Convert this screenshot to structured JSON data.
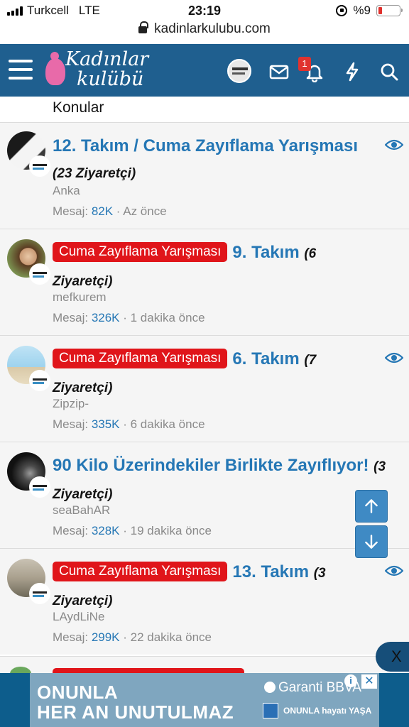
{
  "status_bar": {
    "carrier": "Turkcell",
    "network": "LTE",
    "time": "23:19",
    "battery": "%9",
    "battery_level": 0.09
  },
  "browser": {
    "url": "kadinlarkulubu.com"
  },
  "header": {
    "logo_line1": "Kadınlar",
    "logo_line2": "kulübü",
    "notification_count": "1",
    "colors": {
      "bar": "#1f5f8f",
      "logo_accent": "#e86aa9"
    }
  },
  "section": {
    "label": "Konular"
  },
  "threads": [
    {
      "prefix": "",
      "title": "12. Takım / Cuma Zayıflama Yarışması",
      "visitors": "(23 Ziyaretçi)",
      "author": "Anka",
      "messages_label": "Mesaj:",
      "messages": "82K",
      "time": "· Az önce",
      "watched": true,
      "avatar_icon": "group-banner-avatar"
    },
    {
      "prefix": "Cuma Zayıflama Yarışması",
      "title": "9. Takım",
      "visitors": "(6 Ziyaretçi)",
      "author": "mefkurem",
      "messages_label": "Mesaj:",
      "messages": "326K",
      "time": "· 1 dakika önce",
      "watched": false,
      "avatar_icon": "woman-portrait-avatar"
    },
    {
      "prefix": "Cuma Zayıflama Yarışması",
      "title": "6. Takım",
      "visitors": "(7 Ziyaretçi)",
      "author": "Zipzip-",
      "messages_label": "Mesaj:",
      "messages": "335K",
      "time": "· 6 dakika önce",
      "watched": true,
      "avatar_icon": "beach-runner-avatar"
    },
    {
      "prefix": "",
      "title": "90 Kilo Üzerindekiler Birlikte Zayıflıyor!",
      "visitors": "(3 Ziyaretçi)",
      "author": "seaBahAR",
      "messages_label": "Mesaj:",
      "messages": "328K",
      "time": "· 19 dakika önce",
      "watched": false,
      "avatar_icon": "dark-wave-avatar"
    },
    {
      "prefix": "Cuma Zayıflama Yarışması",
      "title": "13. Takım",
      "visitors": "(3 Ziyaretçi)",
      "author": "LAydLiNe",
      "messages_label": "Mesaj:",
      "messages": "299K",
      "time": "· 22 dakika önce",
      "watched": true,
      "avatar_icon": "sitting-woman-avatar"
    }
  ],
  "controls": {
    "close_label": "X"
  },
  "ad": {
    "line1": "ONUNLA",
    "line2": "HER AN UNUTULMAZ",
    "brand": "Garanti BBVA",
    "slogan": "ONUNLA hayatı YAŞA",
    "info": "i",
    "close": "✕"
  },
  "colors": {
    "link": "#2577b5",
    "prefix_bg": "#e0151a",
    "row_bg": "#f5f5f5",
    "scroll_btn": "#3f8ac4"
  }
}
